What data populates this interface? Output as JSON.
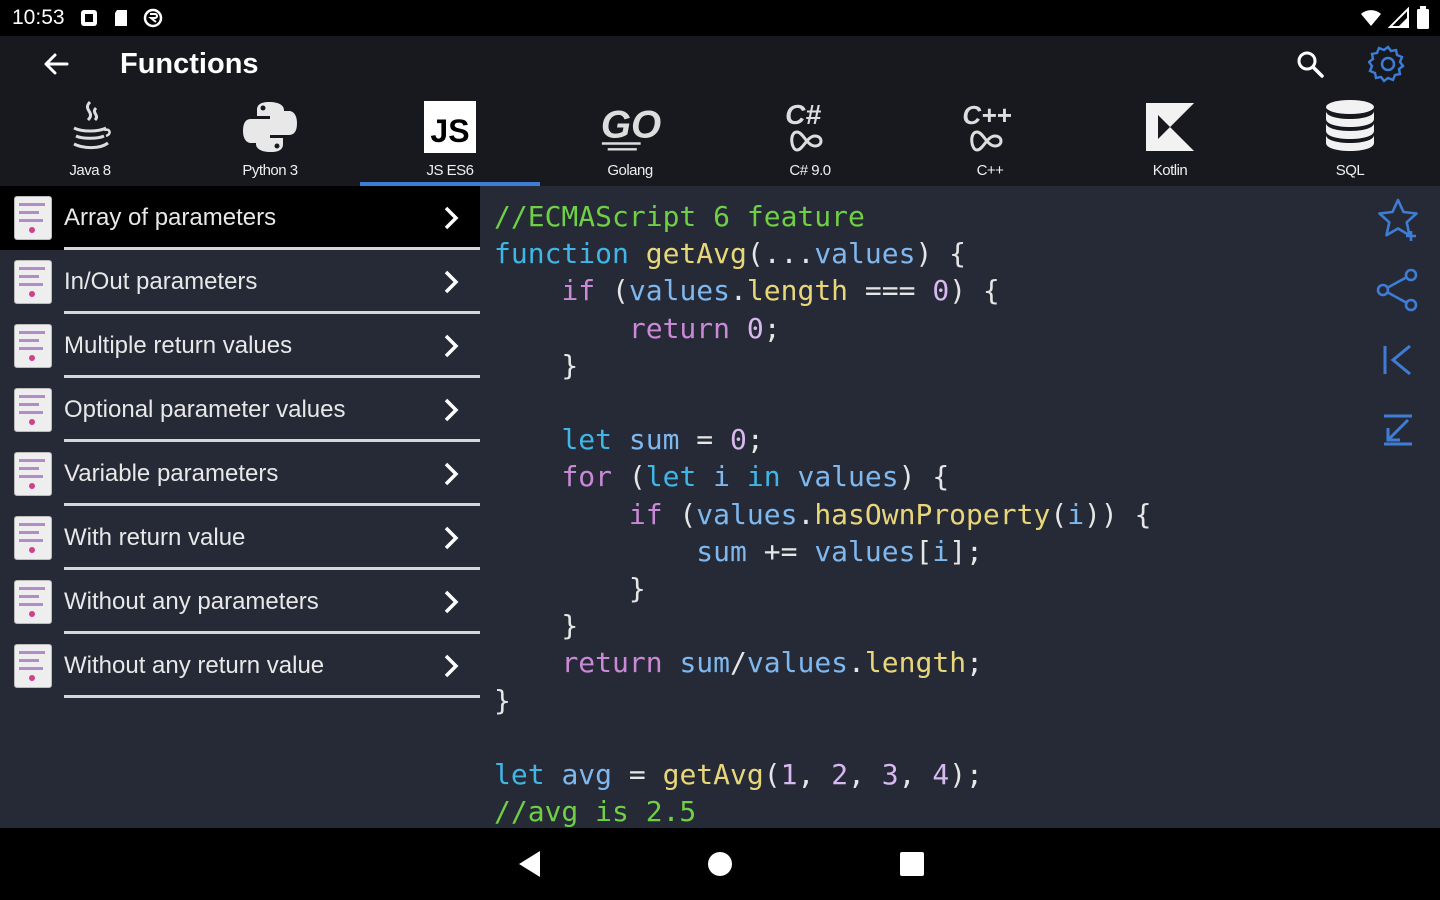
{
  "status": {
    "time": "10:53",
    "icons": [
      "notification-icon",
      "sd-card-icon",
      "sync-icon"
    ],
    "right_icons": [
      "wifi-icon",
      "signal-icon",
      "battery-icon"
    ]
  },
  "appbar": {
    "title": "Functions",
    "back_icon": "arrow-left-icon",
    "search_icon": "search-icon",
    "settings_icon": "gear-icon",
    "accent": "#3d7dd6"
  },
  "languages": [
    {
      "label": "Java 8",
      "icon": "java-icon"
    },
    {
      "label": "Python 3",
      "icon": "python-icon"
    },
    {
      "label": "JS ES6",
      "icon": "javascript-icon",
      "active": true
    },
    {
      "label": "Golang",
      "icon": "golang-icon"
    },
    {
      "label": "C# 9.0",
      "icon": "csharp-icon"
    },
    {
      "label": "C++",
      "icon": "cpp-icon"
    },
    {
      "label": "Kotlin",
      "icon": "kotlin-icon"
    },
    {
      "label": "SQL",
      "icon": "database-icon"
    }
  ],
  "topics": [
    {
      "label": "Array of parameters",
      "selected": true
    },
    {
      "label": "In/Out parameters"
    },
    {
      "label": "Multiple return values"
    },
    {
      "label": "Optional parameter values"
    },
    {
      "label": "Variable parameters"
    },
    {
      "label": "With return value"
    },
    {
      "label": "Without any parameters"
    },
    {
      "label": "Without any return value"
    }
  ],
  "code": {
    "lines": [
      [
        [
          "cm",
          "//ECMAScript 6 feature"
        ]
      ],
      [
        [
          "kw",
          "function"
        ],
        [
          "pl",
          " "
        ],
        [
          "fn",
          "getAvg"
        ],
        [
          "pl",
          "(..."
        ],
        [
          "id",
          "values"
        ],
        [
          "pl",
          ") {"
        ]
      ],
      [
        [
          "pl",
          "    "
        ],
        [
          "ctl",
          "if"
        ],
        [
          "pl",
          " ("
        ],
        [
          "id",
          "values"
        ],
        [
          "pl",
          "."
        ],
        [
          "fn",
          "length"
        ],
        [
          "pl",
          " === "
        ],
        [
          "num",
          "0"
        ],
        [
          "pl",
          ") {"
        ]
      ],
      [
        [
          "pl",
          "        "
        ],
        [
          "ctl",
          "return"
        ],
        [
          "pl",
          " "
        ],
        [
          "num",
          "0"
        ],
        [
          "pl",
          ";"
        ]
      ],
      [
        [
          "pl",
          "    }"
        ]
      ],
      [
        [
          "pl",
          ""
        ]
      ],
      [
        [
          "pl",
          "    "
        ],
        [
          "kw",
          "let"
        ],
        [
          "pl",
          " "
        ],
        [
          "id",
          "sum"
        ],
        [
          "pl",
          " = "
        ],
        [
          "num",
          "0"
        ],
        [
          "pl",
          ";"
        ]
      ],
      [
        [
          "pl",
          "    "
        ],
        [
          "ctl",
          "for"
        ],
        [
          "pl",
          " ("
        ],
        [
          "kw",
          "let"
        ],
        [
          "pl",
          " "
        ],
        [
          "id",
          "i"
        ],
        [
          "pl",
          " "
        ],
        [
          "kw",
          "in"
        ],
        [
          "pl",
          " "
        ],
        [
          "id",
          "values"
        ],
        [
          "pl",
          ") {"
        ]
      ],
      [
        [
          "pl",
          "        "
        ],
        [
          "ctl",
          "if"
        ],
        [
          "pl",
          " ("
        ],
        [
          "id",
          "values"
        ],
        [
          "pl",
          "."
        ],
        [
          "fn",
          "hasOwnProperty"
        ],
        [
          "pl",
          "("
        ],
        [
          "id",
          "i"
        ],
        [
          "pl",
          ")) {"
        ]
      ],
      [
        [
          "pl",
          "            "
        ],
        [
          "id",
          "sum"
        ],
        [
          "pl",
          " += "
        ],
        [
          "id",
          "values"
        ],
        [
          "pl",
          "["
        ],
        [
          "id",
          "i"
        ],
        [
          "pl",
          "];"
        ]
      ],
      [
        [
          "pl",
          "        }"
        ]
      ],
      [
        [
          "pl",
          "    }"
        ]
      ],
      [
        [
          "pl",
          "    "
        ],
        [
          "ctl",
          "return"
        ],
        [
          "pl",
          " "
        ],
        [
          "id",
          "sum"
        ],
        [
          "pl",
          "/"
        ],
        [
          "id",
          "values"
        ],
        [
          "pl",
          "."
        ],
        [
          "fn",
          "length"
        ],
        [
          "pl",
          ";"
        ]
      ],
      [
        [
          "pl",
          "}"
        ]
      ],
      [
        [
          "pl",
          ""
        ]
      ],
      [
        [
          "kw",
          "let"
        ],
        [
          "pl",
          " "
        ],
        [
          "id",
          "avg"
        ],
        [
          "pl",
          " = "
        ],
        [
          "fn",
          "getAvg"
        ],
        [
          "pl",
          "("
        ],
        [
          "num",
          "1"
        ],
        [
          "pl",
          ", "
        ],
        [
          "num",
          "2"
        ],
        [
          "pl",
          ", "
        ],
        [
          "num",
          "3"
        ],
        [
          "pl",
          ", "
        ],
        [
          "num",
          "4"
        ],
        [
          "pl",
          ");"
        ]
      ],
      [
        [
          "cm",
          "//avg is 2.5"
        ]
      ]
    ]
  },
  "side_actions": [
    "star-add-icon",
    "share-icon",
    "first-page-icon",
    "last-page-icon"
  ],
  "nav": [
    "back-triangle-icon",
    "home-circle-icon",
    "recents-square-icon"
  ]
}
